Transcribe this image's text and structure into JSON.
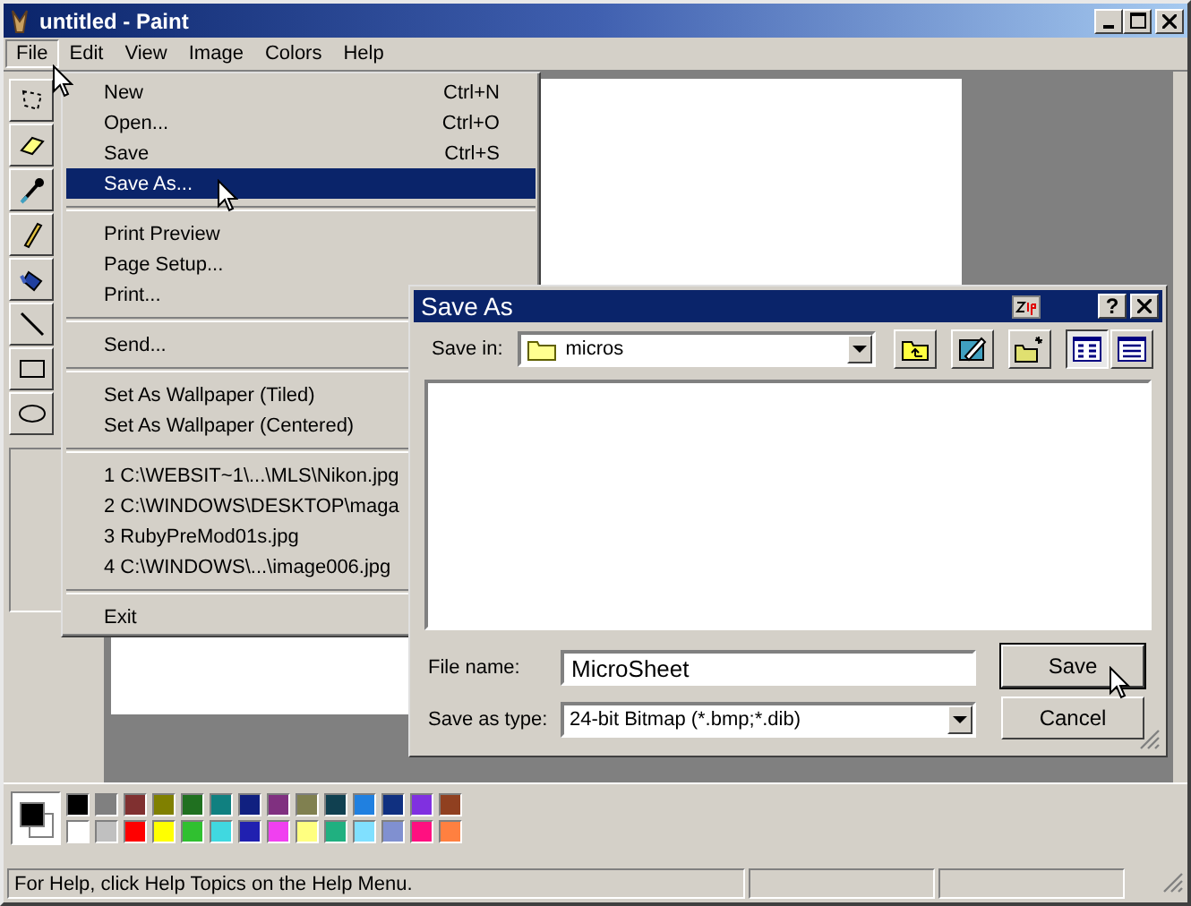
{
  "window": {
    "title": "untitled - Paint"
  },
  "menu_bar": [
    {
      "label": "File",
      "selected": true
    },
    {
      "label": "Edit",
      "selected": false
    },
    {
      "label": "View",
      "selected": false
    },
    {
      "label": "Image",
      "selected": false
    },
    {
      "label": "Colors",
      "selected": false
    },
    {
      "label": "Help",
      "selected": false
    }
  ],
  "file_menu": [
    {
      "kind": "item",
      "label": "New",
      "shortcut": "Ctrl+N",
      "selected": false
    },
    {
      "kind": "item",
      "label": "Open...",
      "shortcut": "Ctrl+O",
      "selected": false
    },
    {
      "kind": "item",
      "label": "Save",
      "shortcut": "Ctrl+S",
      "selected": false
    },
    {
      "kind": "item",
      "label": "Save As...",
      "selected": true
    },
    {
      "kind": "separator"
    },
    {
      "kind": "item",
      "label": "Print Preview",
      "selected": false
    },
    {
      "kind": "item",
      "label": "Page Setup...",
      "selected": false
    },
    {
      "kind": "item",
      "label": "Print...",
      "selected": false
    },
    {
      "kind": "separator"
    },
    {
      "kind": "item",
      "label": "Send...",
      "selected": false
    },
    {
      "kind": "separator"
    },
    {
      "kind": "item",
      "label": "Set As Wallpaper (Tiled)",
      "selected": false
    },
    {
      "kind": "item",
      "label": "Set As Wallpaper (Centered)",
      "selected": false
    },
    {
      "kind": "separator"
    },
    {
      "kind": "item",
      "label": "1 C:\\WEBSIT~1\\...\\MLS\\Nikon.jpg",
      "selected": false
    },
    {
      "kind": "item",
      "label": "2 C:\\WINDOWS\\DESKTOP\\maga",
      "selected": false
    },
    {
      "kind": "item",
      "label": "3 RubyPreMod01s.jpg",
      "selected": false
    },
    {
      "kind": "item",
      "label": "4 C:\\WINDOWS\\...\\image006.jpg",
      "selected": false
    },
    {
      "kind": "separator"
    },
    {
      "kind": "item",
      "label": "Exit",
      "selected": false
    }
  ],
  "palette": [
    {
      "color": "#000000"
    },
    {
      "color": "#808080"
    },
    {
      "color": "#803030"
    },
    {
      "color": "#808000"
    },
    {
      "color": "#207020"
    },
    {
      "color": "#108080"
    },
    {
      "color": "#102080"
    },
    {
      "color": "#803080"
    },
    {
      "color": "#808050"
    },
    {
      "color": "#104050"
    },
    {
      "color": "#2080e0"
    },
    {
      "color": "#103080"
    },
    {
      "color": "#8030e0"
    },
    {
      "color": "#904020"
    },
    {
      "color": "#ffffff"
    },
    {
      "color": "#c0c0c0"
    },
    {
      "color": "#ff0000"
    },
    {
      "color": "#ffff00"
    },
    {
      "color": "#30c030"
    },
    {
      "color": "#40d8e0"
    },
    {
      "color": "#2020b0"
    },
    {
      "color": "#f040f0"
    },
    {
      "color": "#ffff80"
    },
    {
      "color": "#20b080"
    },
    {
      "color": "#80e0ff"
    },
    {
      "color": "#8090d0"
    },
    {
      "color": "#ff1080"
    },
    {
      "color": "#ff8040"
    }
  ],
  "save_dialog": {
    "title": "Save As",
    "help_button": "?",
    "save_in_label": "Save in:",
    "save_in_value": "micros",
    "view_buttons": [
      {
        "kind": "list",
        "selected": true
      },
      {
        "kind": "details",
        "selected": false
      }
    ],
    "file_name_label": "File name:",
    "file_name": "MicroSheet",
    "type_label": "Save as type:",
    "type_value": "24-bit Bitmap (*.bmp;*.dib)",
    "buttons": [
      {
        "label": "Save",
        "default": true
      },
      {
        "label": "Cancel",
        "default": false
      }
    ]
  },
  "status_bar": {
    "text": "For Help, click Help Topics on the Help Menu."
  }
}
